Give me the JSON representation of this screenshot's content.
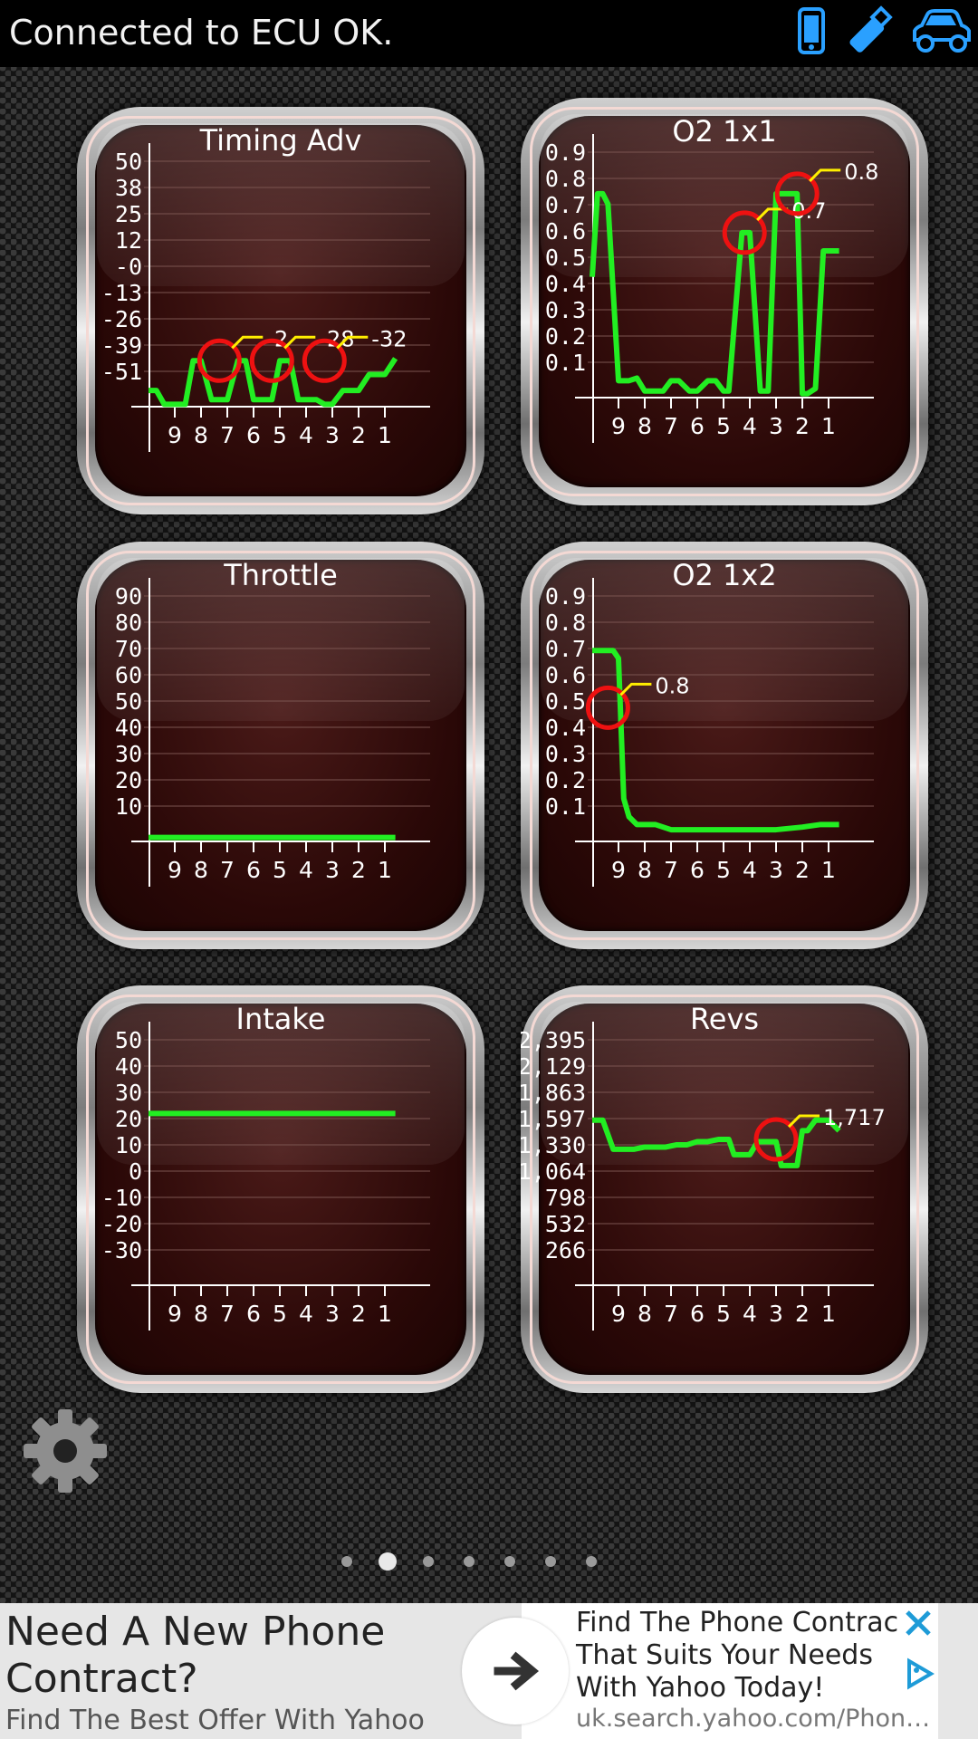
{
  "status": {
    "text": "Connected to ECU OK.",
    "icons": [
      "phone-icon",
      "usb-adapter-icon",
      "car-icon"
    ],
    "icon_color": "#2aa0ff"
  },
  "colors": {
    "trace": "#22ee22",
    "marker": "#ee1111",
    "label_line": "#ffee00",
    "axis": "#ffffff"
  },
  "gauges": [
    {
      "id": "timing-adv",
      "title": "Timing Adv",
      "y_ticks": [
        "50",
        "38",
        "25",
        "12",
        "-0",
        "-13",
        "-26",
        "-39",
        "-51"
      ],
      "x_ticks": [
        "9",
        "8",
        "7",
        "6",
        "5",
        "4",
        "3",
        "2",
        "1"
      ],
      "markers": [
        {
          "x": 7.3,
          "v": -39,
          "label": "-2"
        },
        {
          "x": 5.3,
          "v": -39,
          "label": "-28"
        },
        {
          "x": 3.3,
          "v": -39,
          "label": "-32"
        }
      ]
    },
    {
      "id": "o2-1x1",
      "title": "O2 1x1",
      "y_ticks": [
        "0.9",
        "0.8",
        "0.7",
        "0.6",
        "0.5",
        "0.4",
        "0.3",
        "0.2",
        "0.1"
      ],
      "x_ticks": [
        "9",
        "8",
        "7",
        "6",
        "5",
        "4",
        "3",
        "2",
        "1"
      ],
      "markers": [
        {
          "x": 4.2,
          "v": 0.57,
          "label": "0.7"
        },
        {
          "x": 2.2,
          "v": 0.72,
          "label": "0.8"
        }
      ]
    },
    {
      "id": "throttle",
      "title": "Throttle",
      "y_ticks": [
        "90",
        "80",
        "70",
        "60",
        "50",
        "40",
        "30",
        "20",
        "10"
      ],
      "x_ticks": [
        "9",
        "8",
        "7",
        "6",
        "5",
        "4",
        "3",
        "2",
        "1"
      ],
      "markers": []
    },
    {
      "id": "o2-1x2",
      "title": "O2 1x2",
      "y_ticks": [
        "0.9",
        "0.8",
        "0.7",
        "0.6",
        "0.5",
        "0.4",
        "0.3",
        "0.2",
        "0.1"
      ],
      "x_ticks": [
        "9",
        "8",
        "7",
        "6",
        "5",
        "4",
        "3",
        "2",
        "1"
      ],
      "markers": [
        {
          "x": 9.4,
          "v": 0.45,
          "label": "0.8"
        }
      ]
    },
    {
      "id": "intake",
      "title": "Intake",
      "y_ticks": [
        "50",
        "40",
        "30",
        "20",
        "10",
        "0",
        "-10",
        "-20",
        "-30"
      ],
      "x_ticks": [
        "9",
        "8",
        "7",
        "6",
        "5",
        "4",
        "3",
        "2",
        "1"
      ],
      "markers": []
    },
    {
      "id": "revs",
      "title": "Revs",
      "y_ticks": [
        "2,395",
        "2,129",
        "1,863",
        "1,597",
        "1,330",
        "1,064",
        "798",
        "532",
        "266"
      ],
      "x_ticks": [
        "9",
        "8",
        "7",
        "6",
        "5",
        "4",
        "3",
        "2",
        "1"
      ],
      "markers": [
        {
          "x": 3.0,
          "v": 1420,
          "label": "1,717"
        }
      ]
    }
  ],
  "chart_data": [
    {
      "type": "line",
      "title": "Timing Adv",
      "x": [
        10,
        9.7,
        9.4,
        9,
        8.6,
        8.3,
        8,
        7.6,
        7.3,
        7,
        6.6,
        6.3,
        6,
        5.6,
        5.3,
        5,
        4.6,
        4.3,
        4,
        3.6,
        3.3,
        3,
        2.6,
        2.3,
        2,
        1.6,
        1.3,
        1,
        0.6
      ],
      "y": [
        -52,
        -52,
        -58,
        -58,
        -58,
        -39,
        -39,
        -56,
        -56,
        -56,
        -39,
        -39,
        -56,
        -56,
        -56,
        -39,
        -39,
        -56,
        -56,
        -56,
        -58,
        -58,
        -52,
        -52,
        -52,
        -45,
        -45,
        -45,
        -38
      ],
      "ylim": [
        -63,
        56
      ]
    },
    {
      "type": "line",
      "title": "O2 1x1",
      "x": [
        10,
        9.8,
        9.6,
        9.4,
        9,
        8.8,
        8.6,
        8.3,
        8,
        7.7,
        7.3,
        7,
        6.7,
        6.3,
        6,
        5.6,
        5.3,
        5,
        4.8,
        4.3,
        4,
        3.6,
        3.3,
        3,
        2.8,
        2.6,
        2.2,
        2,
        1.8,
        1.5,
        1.2,
        1,
        0.6
      ],
      "y": [
        0.4,
        0.72,
        0.72,
        0.68,
        0.0,
        0.0,
        0.0,
        0.01,
        -0.04,
        -0.04,
        -0.04,
        0.0,
        0.0,
        -0.04,
        -0.04,
        0.0,
        0.0,
        -0.04,
        -0.04,
        0.57,
        0.57,
        -0.04,
        -0.04,
        0.72,
        0.72,
        0.72,
        0.72,
        -0.05,
        -0.05,
        -0.03,
        0.5,
        0.5,
        0.5
      ],
      "ylim": [
        -0.1,
        0.95
      ]
    },
    {
      "type": "line",
      "title": "Throttle",
      "x": [
        10,
        0.6
      ],
      "y": [
        -5,
        -5
      ],
      "ylim": [
        -10,
        95
      ]
    },
    {
      "type": "line",
      "title": "O2 1x2",
      "x": [
        10,
        9.2,
        9,
        8.8,
        8.6,
        8.3,
        8,
        7.6,
        7,
        6,
        5,
        4,
        3,
        2,
        1.3,
        1,
        0.6
      ],
      "y": [
        0.67,
        0.67,
        0.64,
        0.1,
        0.03,
        0.0,
        0.0,
        0.0,
        -0.02,
        -0.02,
        -0.02,
        -0.02,
        -0.02,
        -0.01,
        0.0,
        0.0,
        0.0
      ],
      "ylim": [
        -0.1,
        0.95
      ]
    },
    {
      "type": "line",
      "title": "Intake",
      "x": [
        10,
        0.6
      ],
      "y": [
        23,
        23
      ],
      "ylim": [
        -40,
        55
      ]
    },
    {
      "type": "line",
      "title": "Revs",
      "x": [
        10,
        9.6,
        9.2,
        8.8,
        8.4,
        8,
        7.6,
        7.2,
        6.8,
        6.4,
        6,
        5.6,
        5.2,
        4.8,
        4.6,
        4.2,
        4,
        3.7,
        3.4,
        3,
        2.8,
        2.6,
        2.2,
        2,
        1.8,
        1.5,
        1.2,
        1,
        0.6
      ],
      "y": [
        1597,
        1597,
        1330,
        1330,
        1330,
        1350,
        1350,
        1350,
        1370,
        1370,
        1400,
        1400,
        1420,
        1420,
        1280,
        1280,
        1280,
        1400,
        1400,
        1400,
        1180,
        1180,
        1180,
        1500,
        1500,
        1597,
        1597,
        1597,
        1500
      ],
      "ylim": [
        0,
        2500
      ]
    }
  ],
  "page_indicator": {
    "count": 7,
    "active": 1
  },
  "ad": {
    "title": "Need A New Phone Contract?",
    "subtitle": "Find The Best Offer With Yahoo",
    "description": "Find The Phone Contract That Suits Your Needs With Yahoo Today!",
    "url": "uk.search.yahoo.com/Phone/..."
  }
}
